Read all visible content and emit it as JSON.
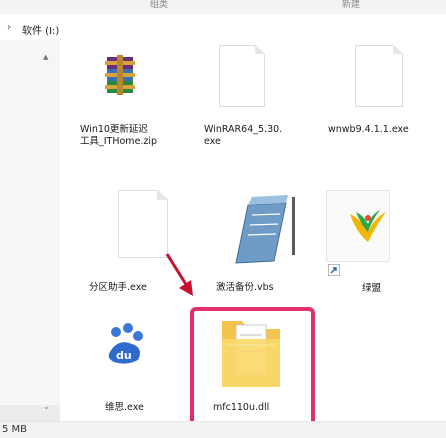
{
  "window": {
    "column_headers": [
      "组类",
      "新建"
    ],
    "drive_label": "软件 (I:)",
    "status_size": "5 MB"
  },
  "files": [
    {
      "name_line1": "Win10更新延迟",
      "name_line2": "工具_ITHome.zip",
      "icon": "winrar-archive-icon"
    },
    {
      "name_line1": "WinRAR64_5.30.",
      "name_line2": "exe",
      "icon": "generic-document-icon"
    },
    {
      "name_line1": "wnwb9.4.1.1.exe",
      "name_line2": "",
      "icon": "generic-document-icon"
    },
    {
      "name_line1": "分区助手.exe",
      "name_line2": "",
      "icon": "generic-document-icon"
    },
    {
      "name_line1": "激活备份.vbs",
      "name_line2": "",
      "icon": "vbs-script-icon"
    },
    {
      "name_line1": "绿盟",
      "name_line2": "",
      "icon": "lvmeng-app-icon"
    },
    {
      "name_line1": "维思.exe",
      "name_line2": "",
      "icon": "paw-app-icon"
    },
    {
      "name_line1": "mfc110u.dll",
      "name_line2": "",
      "icon": "folder-icon"
    }
  ],
  "annotation": {
    "highlight_color": "#e0306a",
    "arrow_color": "#c8102e"
  }
}
